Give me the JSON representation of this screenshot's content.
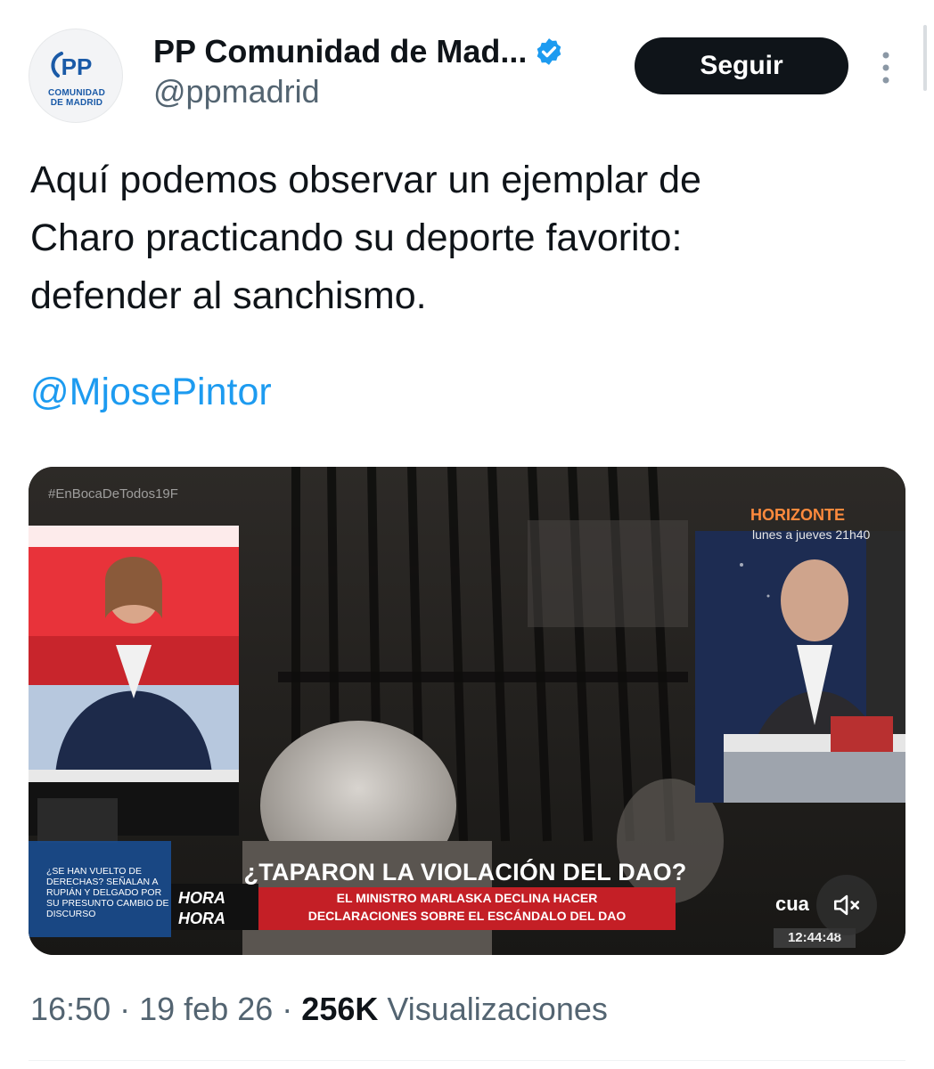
{
  "account": {
    "display_name": "PP Comunidad de Mad...",
    "handle": "@ppmadrid",
    "verified": true,
    "avatar_logo_text": "PP",
    "avatar_caption_line1": "COMUNIDAD",
    "avatar_caption_line2": "DE MADRID"
  },
  "follow_button": {
    "label": "Seguir"
  },
  "more_icon": "more-vertical-icon",
  "tweet": {
    "text_line1": "Aquí podemos observar un ejemplar de",
    "text_line2": "Charo practicando su deporte favorito:",
    "text_line3": "defender al sanchismo.",
    "mention": "@MjosePintor"
  },
  "video": {
    "overlay_hashtag": "#EnBocaDeTodos19F",
    "program_name": "HORIZONTE",
    "program_schedule": "lunes a jueves 21h40",
    "headline": "¿TAPARON LA VIOLACIÓN DEL DAO?",
    "subheadline_line1": "EL MINISTRO MARLASKA DECLINA HACER",
    "subheadline_line2": "DECLARACIONES SOBRE EL ESCÁNDALO DEL DAO",
    "hora_line1": "HORA",
    "hora_line2": "HORA",
    "ticker_text": "¿SE HAN VUELTO DE DERECHAS? SEÑALAN A RUPIÁN Y DELGADO POR SU PRESUNTO CAMBIO DE DISCURSO",
    "channel_logo": "cua",
    "clock": "12:44:48",
    "mute_icon": "volume-muted-icon"
  },
  "meta": {
    "time": "16:50",
    "separator": "·",
    "date": "19 feb 26",
    "views_count": "256K",
    "views_label": "Visualizaciones"
  },
  "colors": {
    "text_primary": "#0f1419",
    "text_secondary": "#536471",
    "link": "#1d9bf0",
    "verified_badge": "#1d9bf0",
    "follow_button_bg": "#0f1419",
    "brand_pp": "#1a5aa7",
    "news_red": "#c41f26"
  }
}
